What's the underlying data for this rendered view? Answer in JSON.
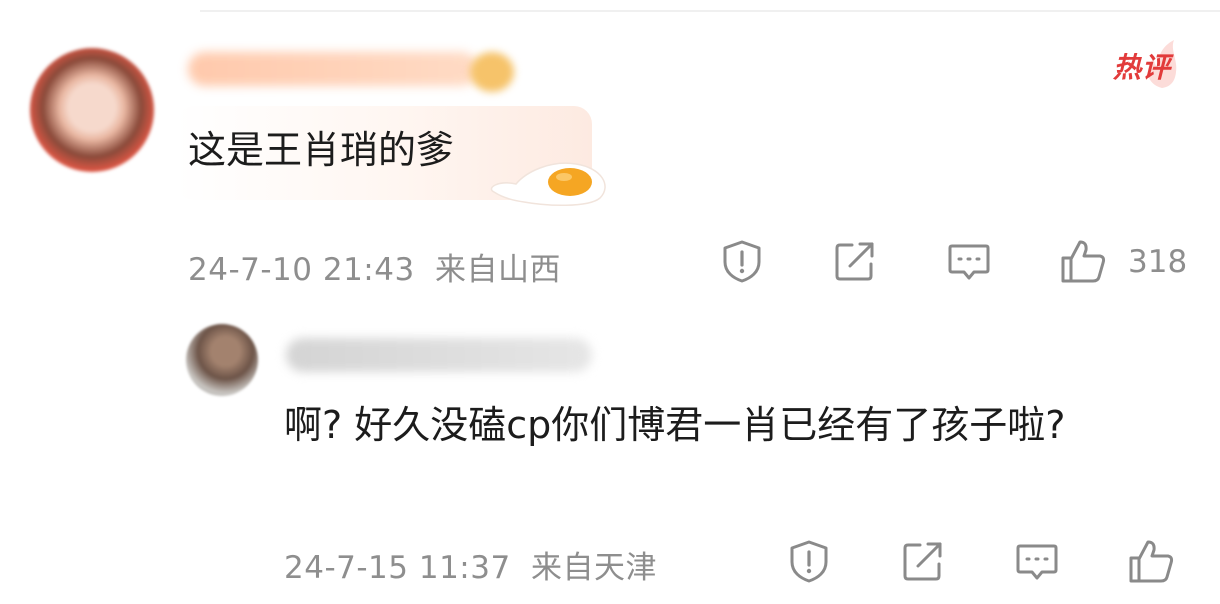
{
  "main_comment": {
    "hot_badge_label": "热评",
    "text": "这是王肖琑的爹",
    "date": "24-7-10 21:43",
    "location": "来自山西",
    "like_count": "318"
  },
  "reply_comment": {
    "text": "啊? 好久没磕cp你们博君一肖已经有了孩子啦?",
    "date": "24-7-15 11:37",
    "location": "来自天津"
  },
  "icons": {
    "report": "shield-exclamation-icon",
    "share": "share-arrow-icon",
    "comment": "comment-bubble-icon",
    "like": "thumbs-up-icon",
    "decoration": "fried-egg-icon"
  },
  "colors": {
    "hot_badge": "#e23b3b",
    "meta_text": "#8e8e8e",
    "icon_stroke": "#8a8a8a"
  }
}
